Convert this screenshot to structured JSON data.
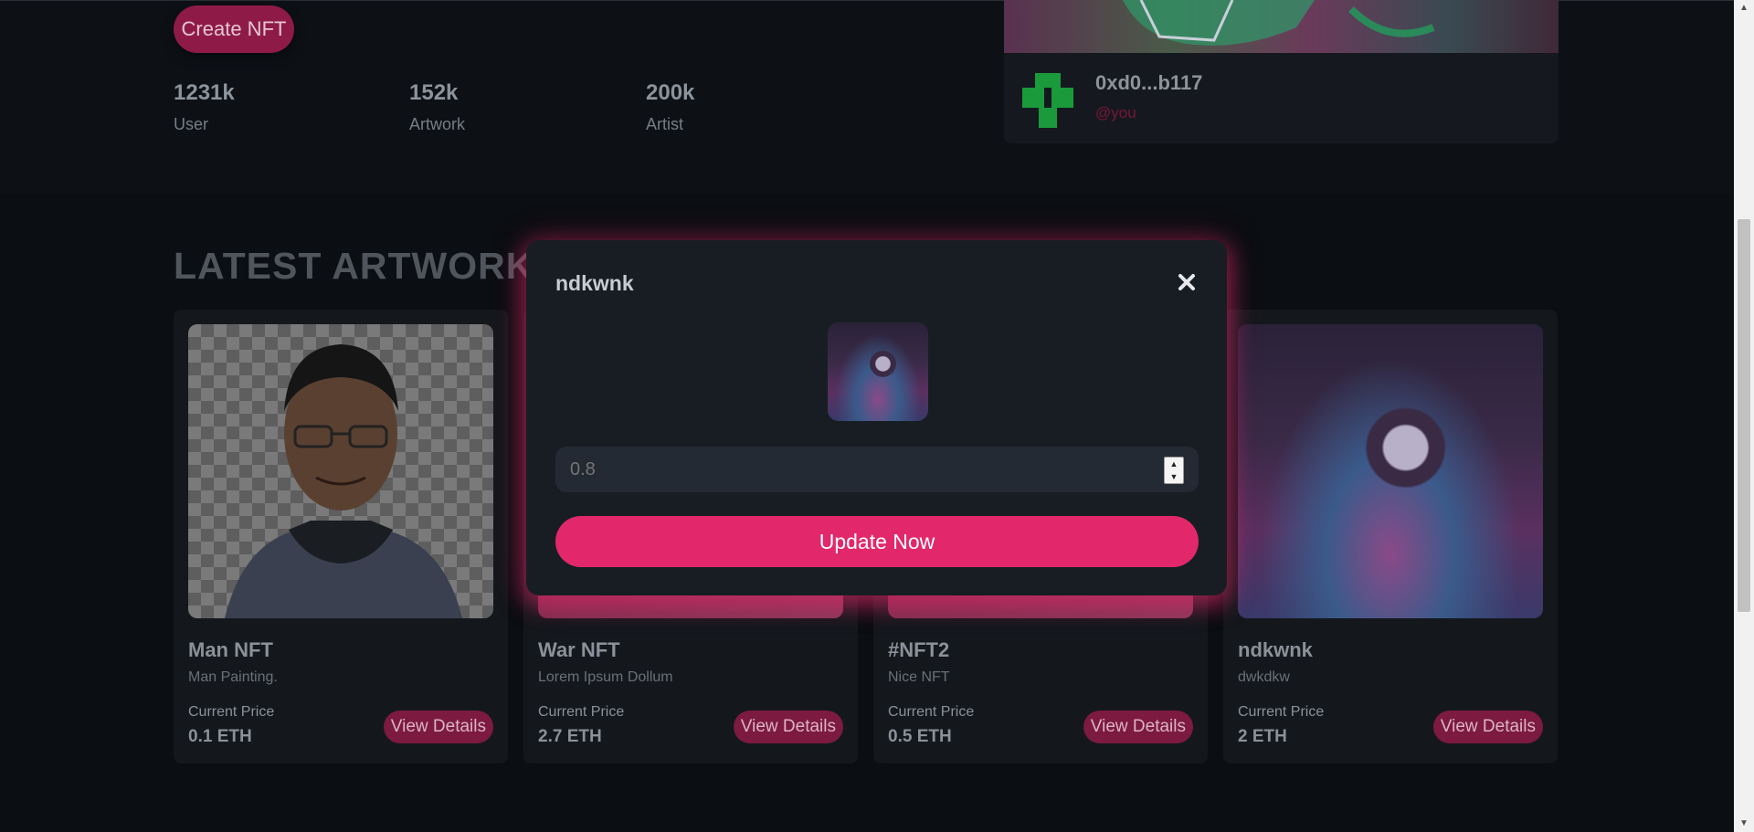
{
  "hero": {
    "create_button": "Create NFT",
    "stats": [
      {
        "value": "1231k",
        "label": "User"
      },
      {
        "value": "152k",
        "label": "Artwork"
      },
      {
        "value": "200k",
        "label": "Artist"
      }
    ]
  },
  "featured": {
    "address": "0xd0...b117",
    "handle": "@you"
  },
  "section_title": "LATEST ARTWORKS",
  "cards": [
    {
      "title": "Man NFT",
      "desc": "Man Painting.",
      "price_label": "Current Price",
      "price": "0.1 ETH",
      "button": "View Details",
      "image_icon": "portrait-image"
    },
    {
      "title": "War NFT",
      "desc": "Lorem Ipsum Dollum",
      "price_label": "Current Price",
      "price": "2.7 ETH",
      "button": "View Details",
      "image_icon": "artwork-image"
    },
    {
      "title": "#NFT2",
      "desc": "Nice NFT",
      "price_label": "Current Price",
      "price": "0.5 ETH",
      "button": "View Details",
      "image_icon": "artwork-image"
    },
    {
      "title": "ndkwnk",
      "desc": "dwkdkw",
      "price_label": "Current Price",
      "price": "2 ETH",
      "button": "View Details",
      "image_icon": "astronaut-image"
    }
  ],
  "modal": {
    "title": "ndkwnk",
    "close_icon": "close-icon",
    "price_placeholder": "0.8",
    "update_button": "Update Now"
  },
  "colors": {
    "accent": "#e2286a",
    "background": "#0b0e12",
    "card": "#14181d",
    "modal": "#181d24",
    "avatar_green": "#1a9a3a"
  }
}
